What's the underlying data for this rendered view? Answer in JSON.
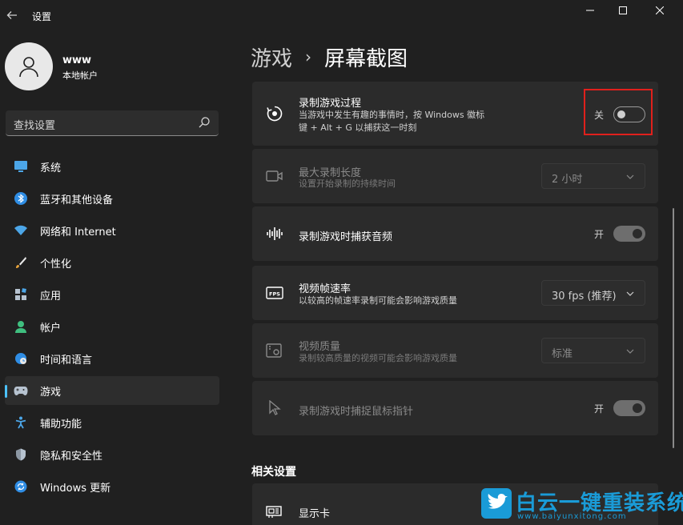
{
  "window": {
    "app_title": "设置"
  },
  "profile": {
    "name": "www",
    "account_type": "本地帐户"
  },
  "search": {
    "placeholder": "查找设置"
  },
  "sidebar": {
    "items": [
      {
        "label": "系统",
        "icon": "monitor-icon"
      },
      {
        "label": "蓝牙和其他设备",
        "icon": "bluetooth-icon"
      },
      {
        "label": "网络和 Internet",
        "icon": "wifi-icon"
      },
      {
        "label": "个性化",
        "icon": "brush-icon"
      },
      {
        "label": "应用",
        "icon": "apps-icon"
      },
      {
        "label": "帐户",
        "icon": "person-icon"
      },
      {
        "label": "时间和语言",
        "icon": "globe-clock-icon"
      },
      {
        "label": "游戏",
        "icon": "gamepad-icon",
        "active": true
      },
      {
        "label": "辅助功能",
        "icon": "accessibility-icon"
      },
      {
        "label": "隐私和安全性",
        "icon": "shield-icon"
      },
      {
        "label": "Windows 更新",
        "icon": "update-icon"
      }
    ]
  },
  "breadcrumb": {
    "parent": "游戏",
    "separator": "›",
    "current": "屏幕截图"
  },
  "settings": {
    "record_game": {
      "title": "录制游戏过程",
      "desc_line1": "当游戏中发生有趣的事情时，按 Windows 徽标",
      "desc_line2": "键 + Alt + G 以捕获这一时刻",
      "state": "关"
    },
    "max_length": {
      "title": "最大录制长度",
      "desc": "设置开始录制的持续时间",
      "value": "2 小时"
    },
    "capture_audio": {
      "title": "录制游戏时捕获音频",
      "state": "开"
    },
    "frame_rate": {
      "title": "视频帧速率",
      "desc": "以较高的帧速率录制可能会影响游戏质量",
      "value": "30 fps (推荐)"
    },
    "video_quality": {
      "title": "视频质量",
      "desc": "录制较高质量的视频可能会影响游戏质量",
      "value": "标准"
    },
    "capture_cursor": {
      "title": "录制游戏时捕捉鼠标指针",
      "state": "开"
    }
  },
  "related": {
    "section_title": "相关设置",
    "graphics_card": "显示卡"
  },
  "watermark": {
    "cn": "白云一键重装系统",
    "en": "www.baiyunxitong.com"
  },
  "colors": {
    "accent": "#4cc2ff",
    "highlight": "#e0201c",
    "watermark": "#1a9bd7"
  }
}
